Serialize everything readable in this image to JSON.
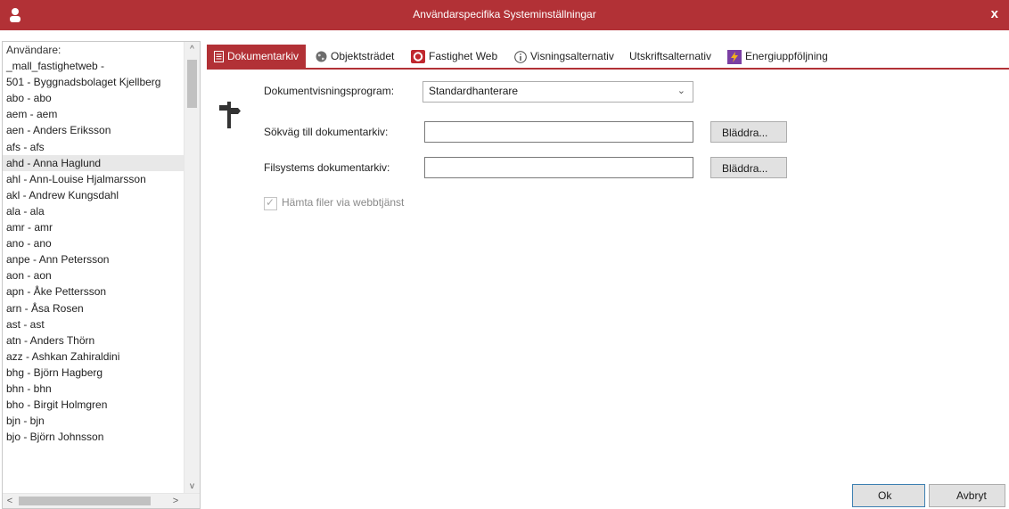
{
  "window": {
    "title": "Användarspecifika Systeminställningar",
    "close_label": "x"
  },
  "users": {
    "header": "Användare:",
    "items": [
      "_mall_fastighetweb -",
      "501 - Byggnadsbolaget Kjellberg",
      "abo - abo",
      "aem - aem",
      "aen - Anders Eriksson",
      "afs - afs",
      "ahd - Anna Haglund",
      "ahl - Ann-Louise Hjalmarsson",
      "akl - Andrew Kungsdahl",
      "ala - ala",
      "amr - amr",
      "ano - ano",
      "anpe - Ann Petersson",
      "aon - aon",
      "apn - Åke Pettersson",
      "arn - Åsa Rosen",
      "ast - ast",
      "atn - Anders Thörn",
      "azz - Ashkan Zahiraldini",
      "bhg - Björn Hagberg",
      "bhn - bhn",
      "bho - Birgit Holmgren",
      "bjn - bjn",
      "bjo - Björn Johnsson"
    ],
    "selected_index": 6
  },
  "scroll": {
    "up": "^",
    "down": "v",
    "left": "<",
    "right": ">"
  },
  "tabs": [
    {
      "label": "Dokumentarkiv",
      "icon": "document-icon",
      "active": true
    },
    {
      "label": "Objektsträdet",
      "icon": "globe-icon",
      "active": false
    },
    {
      "label": "Fastighet Web",
      "icon": "web-icon",
      "active": false
    },
    {
      "label": "Visningsalternativ",
      "icon": "info-icon",
      "active": false
    },
    {
      "label": "Utskriftsalternativ",
      "icon": "",
      "active": false
    },
    {
      "label": "Energiuppföljning",
      "icon": "energy-icon",
      "active": false
    }
  ],
  "form": {
    "viewer_label": "Dokumentvisningsprogram:",
    "viewer_value": "Standardhanterare",
    "path_label": "Sökväg till dokumentarkiv:",
    "path_value": "",
    "fs_label": "Filsystems dokumentarkiv:",
    "fs_value": "",
    "browse_label": "Bläddra...",
    "webservice_label": "Hämta filer via webbtjänst",
    "webservice_checked": true,
    "webservice_enabled": false
  },
  "footer": {
    "ok_label": "Ok",
    "cancel_label": "Avbryt"
  },
  "colors": {
    "accent": "#b23136"
  }
}
